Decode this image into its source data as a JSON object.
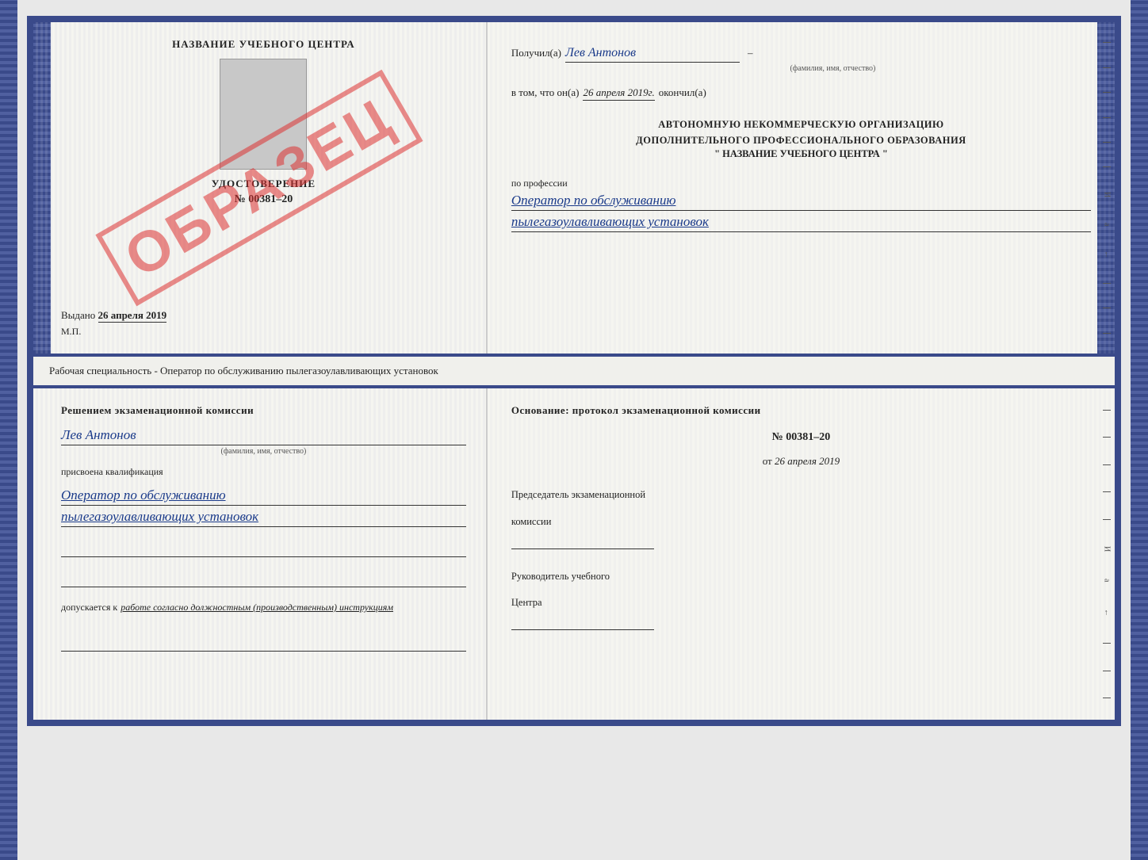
{
  "top_cert": {
    "left": {
      "school_title": "НАЗВАНИЕ УЧЕБНОГО ЦЕНТРА",
      "watermark": "ОБРАЗЕЦ",
      "udostoverenie_label": "УДОСТОВЕРЕНИЕ",
      "cert_number": "№ 00381–20",
      "vydano_label": "Выдано",
      "vydano_date": "26 апреля 2019",
      "mp_label": "М.П."
    },
    "right": {
      "poluchil_label": "Получил(а)",
      "poluchil_name": "Лев Антонов",
      "fio_hint": "(фамилия, имя, отчество)",
      "dash": "–",
      "vtom_label": "в том, что он(а)",
      "vtom_date": "26 апреля 2019г.",
      "okonchil_label": "окончил(а)",
      "org_line1": "АВТОНОМНУЮ НЕКОММЕРЧЕСКУЮ ОРГАНИЗАЦИЮ",
      "org_line2": "ДОПОЛНИТЕЛЬНОГО ПРОФЕССИОНАЛЬНОГО ОБРАЗОВАНИЯ",
      "org_line3": "\"   НАЗВАНИЕ УЧЕБНОГО ЦЕНТРА   \"",
      "po_professii": "по профессии",
      "profession1": "Оператор по обслуживанию",
      "profession2": "пылегазоулавливающих установок"
    }
  },
  "middle": {
    "text": "Рабочая специальность - Оператор по обслуживанию пылегазоулавливающих установок"
  },
  "bottom_cert": {
    "left": {
      "resheniyem_label": "Решением экзаменационной комиссии",
      "person_name": "Лев Антонов",
      "fio_hint": "(фамилия, имя, отчество)",
      "prisvoena_label": "присвоена квалификация",
      "kvali1": "Оператор по обслуживанию",
      "kvali2": "пылегазоулавливающих установок",
      "dopuskaetsya_label": "допускается к",
      "dopuskaetsya_text": "работе согласно должностным (производственным) инструкциям"
    },
    "right": {
      "osnovanie_label": "Основание: протокол экзаменационной комиссии",
      "protocol_number": "№ 00381–20",
      "ot_label": "от",
      "ot_date": "26 апреля 2019",
      "predsedatel_label": "Председатель экзаменационной",
      "predsedatel_label2": "комиссии",
      "rukovoditel_label": "Руководитель учебного",
      "rukovoditel_label2": "Центра"
    }
  }
}
